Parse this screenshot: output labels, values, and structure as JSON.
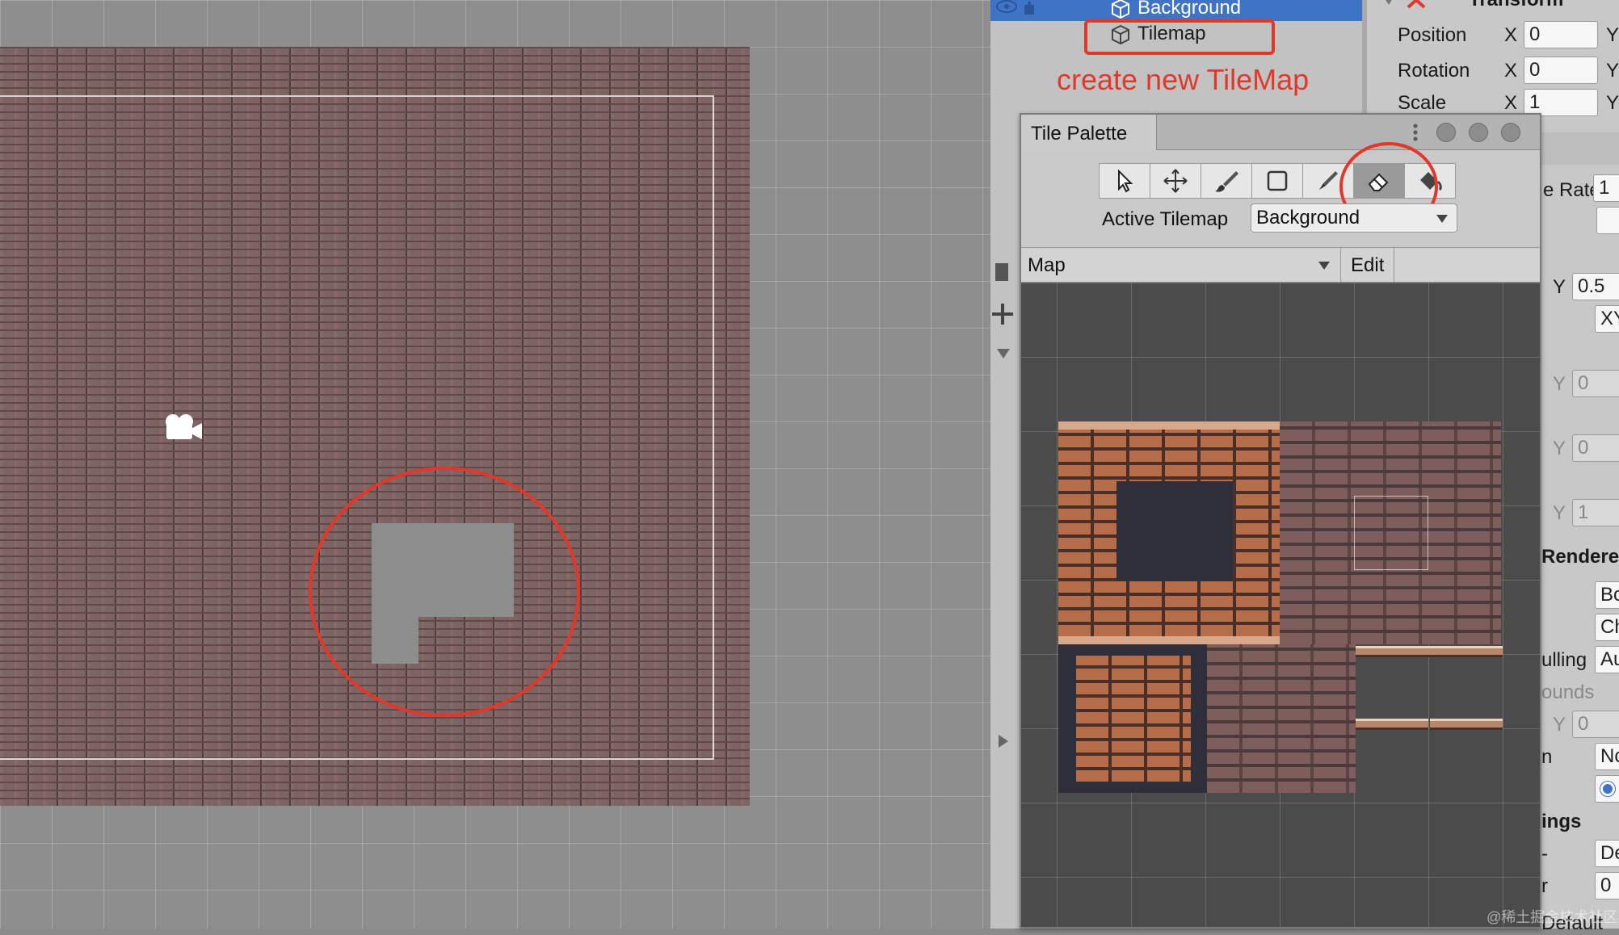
{
  "hierarchy": {
    "items": [
      {
        "label": "Background",
        "selected": true
      },
      {
        "label": "Tilemap",
        "selected": false
      }
    ],
    "annotation": "create new TileMap"
  },
  "inspector": {
    "header": "Transform",
    "rows": [
      {
        "label": "Position",
        "x": "0",
        "y_label": "Y"
      },
      {
        "label": "Rotation",
        "x": "0",
        "y_label": "Y"
      },
      {
        "label": "Scale",
        "x": "1",
        "y_label": "Y"
      }
    ],
    "x_label": "X",
    "rate_label": "e Rate",
    "rate_value": "1",
    "y_values": [
      {
        "label": "Y",
        "value": "0.5"
      },
      {
        "label": "Y",
        "value": "0"
      },
      {
        "label": "Y",
        "value": "0"
      },
      {
        "label": "Y",
        "value": "1"
      },
      {
        "label": "Y",
        "value": "0"
      }
    ],
    "xy_value": "XY",
    "renderer_header": "Rendere",
    "fields": [
      "Bo",
      "Ch",
      "Au",
      "Nc",
      "De",
      "0"
    ],
    "culling_label": "ulling",
    "bounds_label": "ounds",
    "n_label": "n",
    "settings_label": "ings",
    "r_label": "r",
    "dash_label": "-",
    "sub_label": "Default"
  },
  "tile_palette": {
    "title": "Tile Palette",
    "tools": [
      "select-tool",
      "move-tool",
      "paint-tool",
      "box-fill-tool",
      "picker-tool",
      "eraser-tool",
      "fill-tool"
    ],
    "active_tool": "eraser-tool",
    "active_tilemap_label": "Active Tilemap",
    "active_tilemap_value": "Background",
    "palette_select": "Map",
    "edit_label": "Edit"
  },
  "watermark": "@稀土掘金技术社区",
  "colors": {
    "annotation_red": "#e0392b",
    "selection_blue": "#3f73c5"
  }
}
